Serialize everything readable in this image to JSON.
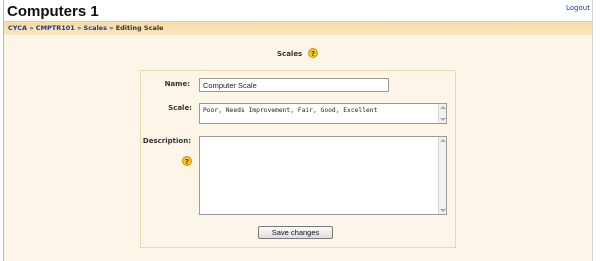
{
  "header": {
    "site_title": "Computers 1",
    "logout_label": "Logout"
  },
  "breadcrumb": {
    "items": [
      "CYCA",
      "CMPTR101",
      "Scales"
    ],
    "current": "Editing Scale",
    "separator": "»"
  },
  "page": {
    "heading": "Scales",
    "help_glyph": "?"
  },
  "form": {
    "name_label": "Name:",
    "name_value": "Computer Scale",
    "scale_label": "Scale:",
    "scale_value": "Poor, Needs Improvement, Fair, Good, Excellent",
    "description_label": "Description:",
    "description_value": "",
    "save_label": "Save changes"
  },
  "colors": {
    "navbar": "#f7d9a3",
    "content_background": "#fdf6e8",
    "link": "#1a3c8f",
    "help_icon": "#f4c430"
  }
}
